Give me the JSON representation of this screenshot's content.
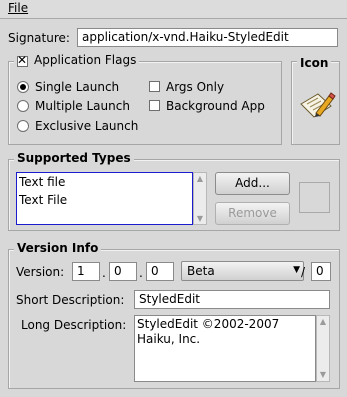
{
  "menu": {
    "file_label": "File"
  },
  "signature": {
    "label": "Signature:",
    "value": "application/x-vnd.Haiku-StyledEdit"
  },
  "app_flags": {
    "title": "Application Flags",
    "checked": true,
    "launch_options": [
      "Single Launch",
      "Multiple Launch",
      "Exclusive Launch"
    ],
    "selected_launch": "Single Launch",
    "args_only": "Args Only",
    "background_app": "Background App"
  },
  "icon_box": {
    "title": "Icon",
    "icon": "pencil-paper-icon"
  },
  "supported_types": {
    "title": "Supported Types",
    "items": [
      "Text file",
      "Text File"
    ],
    "add_label": "Add...",
    "remove_label": "Remove"
  },
  "version_info": {
    "title": "Version Info",
    "version_label": "Version:",
    "major": "1",
    "middle": "0",
    "minor": "0",
    "variety": "Beta",
    "slash": "/",
    "internal": "0",
    "short_desc_label": "Short Description:",
    "short_desc": "StyledEdit",
    "long_desc_label": "Long Description:",
    "long_desc_line1": "StyledEdit ©2002-2007",
    "long_desc_line2": "Haiku, Inc."
  },
  "colors": {
    "background": "#d8d8d8",
    "list_focus_border": "#1c1ccf"
  }
}
